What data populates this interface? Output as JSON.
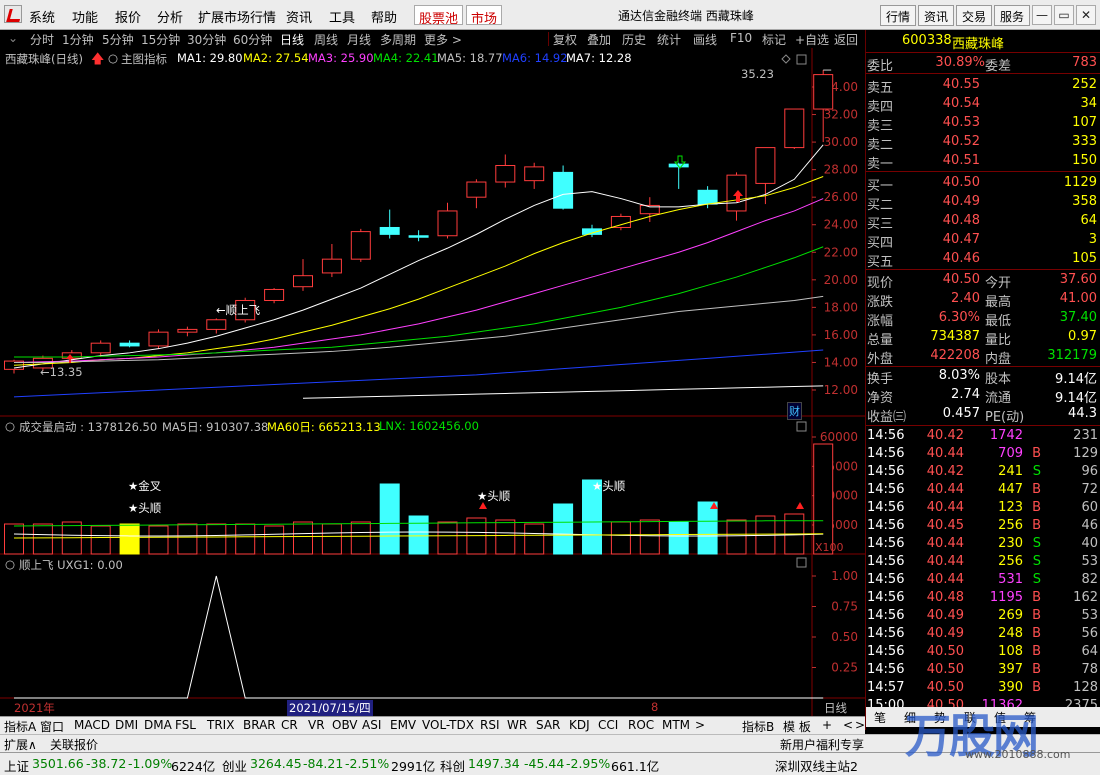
{
  "menu": {
    "items": [
      "系统",
      "功能",
      "报价",
      "分析",
      "扩展市场行情",
      "资讯",
      "工具",
      "帮助"
    ],
    "stock_pool": "股票池",
    "market": "市场"
  },
  "window": {
    "title": "通达信金融终端  西藏珠峰"
  },
  "right_buttons": [
    "行情",
    "资讯",
    "交易",
    "服务"
  ],
  "period_tabs": [
    "分时",
    "1分钟",
    "5分钟",
    "15分钟",
    "30分钟",
    "60分钟",
    "日线",
    "周线",
    "月线",
    "多周期",
    "更多 >"
  ],
  "selected_period": "日线",
  "tool_buttons": [
    "复权",
    "叠加",
    "历史",
    "统计",
    "画线",
    "F10",
    "标记",
    "+自选",
    "返回"
  ],
  "chart": {
    "stock_label": "西藏珠峰(日线)",
    "indicator_label": "主图指标",
    "ma": [
      {
        "label": "MA1: 29.80",
        "color": "#ffffff"
      },
      {
        "label": "MA2: 27.54",
        "color": "#ffff00"
      },
      {
        "label": "MA3: 25.90",
        "color": "#ff40ff"
      },
      {
        "label": "MA4: 22.41",
        "color": "#00e000"
      },
      {
        "label": "MA5: 18.77",
        "color": "#c0c0c0"
      },
      {
        "label": "MA6: 14.92",
        "color": "#2040ff"
      },
      {
        "label": "MA7: 12.28",
        "color": "#ffffff"
      }
    ],
    "high_label": "35.23",
    "low_label": "13.35",
    "annotation": "顺上飞",
    "fin_badge": "财",
    "y_ticks": [
      "34.00",
      "32.00",
      "30.00",
      "28.00",
      "26.00",
      "24.00",
      "22.00",
      "20.00",
      "18.00",
      "16.00",
      "14.00",
      "12.00"
    ]
  },
  "chart_data": {
    "type": "candlestick",
    "candles": [
      {
        "o": 13.5,
        "h": 14.2,
        "l": 13.2,
        "c": 14.1
      },
      {
        "o": 13.6,
        "h": 14.5,
        "l": 13.4,
        "c": 14.3
      },
      {
        "o": 14.3,
        "h": 14.9,
        "l": 14.0,
        "c": 14.7
      },
      {
        "o": 14.7,
        "h": 15.6,
        "l": 14.4,
        "c": 15.4
      },
      {
        "o": 15.4,
        "h": 15.6,
        "l": 15.1,
        "c": 15.2
      },
      {
        "o": 15.2,
        "h": 16.4,
        "l": 15.0,
        "c": 16.2
      },
      {
        "o": 16.2,
        "h": 16.6,
        "l": 15.9,
        "c": 16.4
      },
      {
        "o": 16.4,
        "h": 17.2,
        "l": 16.1,
        "c": 17.1
      },
      {
        "o": 17.1,
        "h": 18.7,
        "l": 16.9,
        "c": 18.5
      },
      {
        "o": 18.5,
        "h": 19.4,
        "l": 18.3,
        "c": 19.3
      },
      {
        "o": 19.5,
        "h": 21.5,
        "l": 19.2,
        "c": 20.3
      },
      {
        "o": 20.5,
        "h": 22.6,
        "l": 20.2,
        "c": 21.5
      },
      {
        "o": 21.5,
        "h": 23.7,
        "l": 21.3,
        "c": 23.5
      },
      {
        "o": 23.8,
        "h": 25.1,
        "l": 23.0,
        "c": 23.3
      },
      {
        "o": 23.2,
        "h": 23.6,
        "l": 22.8,
        "c": 23.1
      },
      {
        "o": 23.2,
        "h": 25.6,
        "l": 23.0,
        "c": 25.0
      },
      {
        "o": 26.0,
        "h": 27.3,
        "l": 25.2,
        "c": 27.1
      },
      {
        "o": 27.1,
        "h": 29.1,
        "l": 26.7,
        "c": 28.3
      },
      {
        "o": 27.2,
        "h": 28.5,
        "l": 26.6,
        "c": 28.2
      },
      {
        "o": 27.8,
        "h": 28.3,
        "l": 25.1,
        "c": 25.2
      },
      {
        "o": 23.7,
        "h": 24.0,
        "l": 23.1,
        "c": 23.3
      },
      {
        "o": 23.8,
        "h": 24.8,
        "l": 23.6,
        "c": 24.6
      },
      {
        "o": 24.8,
        "h": 26.0,
        "l": 24.2,
        "c": 25.4
      },
      {
        "o": 28.4,
        "h": 28.5,
        "l": 26.6,
        "c": 28.2
      },
      {
        "o": 26.5,
        "h": 26.8,
        "l": 25.2,
        "c": 25.5
      },
      {
        "o": 25.0,
        "h": 27.8,
        "l": 24.3,
        "c": 27.6
      },
      {
        "o": 27.0,
        "h": 29.6,
        "l": 25.5,
        "c": 29.6
      },
      {
        "o": 29.6,
        "h": 32.4,
        "l": 29.5,
        "c": 32.4
      },
      {
        "o": 32.4,
        "h": 35.23,
        "l": 30.0,
        "c": 34.9
      }
    ],
    "ma_series": [
      {
        "name": "MA1",
        "values": [
          13.6,
          13.9,
          14.2,
          14.5,
          14.7,
          15.0,
          15.4,
          15.9,
          16.5,
          17.1,
          17.8,
          18.6,
          19.4,
          20.4,
          21.4,
          22.3,
          23.3,
          24.4,
          25.4,
          26.2,
          26.4,
          25.9,
          25.3,
          25.3,
          25.5,
          25.6,
          26.2,
          27.3,
          29.8
        ]
      },
      {
        "name": "MA2",
        "values": [
          13.8,
          13.9,
          14.0,
          14.2,
          14.3,
          14.5,
          14.7,
          15.0,
          15.3,
          15.7,
          16.2,
          16.7,
          17.3,
          17.9,
          18.6,
          19.4,
          20.2,
          21.0,
          21.9,
          22.7,
          23.4,
          24.0,
          24.6,
          25.1,
          25.5,
          25.8,
          26.1,
          26.7,
          27.5
        ]
      },
      {
        "name": "MA3",
        "values": [
          14.0,
          14.05,
          14.1,
          14.2,
          14.3,
          14.4,
          14.55,
          14.7,
          14.9,
          15.1,
          15.4,
          15.7,
          16.0,
          16.4,
          16.8,
          17.3,
          17.8,
          18.4,
          19.0,
          19.6,
          20.2,
          20.8,
          21.4,
          22.0,
          22.7,
          23.5,
          24.3,
          25.0,
          25.9
        ]
      },
      {
        "name": "MA4",
        "values": [
          14.4,
          14.4,
          14.4,
          14.45,
          14.5,
          14.55,
          14.6,
          14.7,
          14.8,
          14.9,
          15.0,
          15.1,
          15.3,
          15.5,
          15.7,
          15.9,
          16.2,
          16.5,
          16.8,
          17.2,
          17.6,
          18.0,
          18.5,
          19.0,
          19.6,
          20.2,
          20.9,
          21.6,
          22.4
        ]
      },
      {
        "name": "MA5",
        "values": [
          14.0,
          14.0,
          14.05,
          14.1,
          14.15,
          14.2,
          14.3,
          14.4,
          14.5,
          14.6,
          14.7,
          14.8,
          14.95,
          15.1,
          15.3,
          15.5,
          15.7,
          15.9,
          16.2,
          16.5,
          16.8,
          17.1,
          17.4,
          17.7,
          17.9,
          18.1,
          18.3,
          18.5,
          18.8
        ]
      },
      {
        "name": "MA6",
        "values": [
          11.5,
          11.6,
          11.7,
          11.8,
          11.9,
          12.0,
          12.1,
          12.2,
          12.3,
          12.4,
          12.5,
          12.6,
          12.7,
          12.8,
          12.9,
          13.0,
          13.1,
          13.25,
          13.4,
          13.55,
          13.7,
          13.85,
          14.0,
          14.15,
          14.3,
          14.45,
          14.6,
          14.75,
          14.9
        ]
      },
      {
        "name": "MA7",
        "values": [
          null,
          null,
          null,
          null,
          null,
          null,
          null,
          null,
          null,
          null,
          11.4,
          11.45,
          11.5,
          11.55,
          11.6,
          11.65,
          11.7,
          11.75,
          11.8,
          11.85,
          11.9,
          11.95,
          12.0,
          12.05,
          12.1,
          12.15,
          12.2,
          12.25,
          12.3
        ]
      }
    ],
    "volume": [
      150000,
      150000,
      160000,
      140000,
      150000,
      140000,
      150000,
      150000,
      150000,
      140000,
      160000,
      150000,
      160000,
      350000,
      190000,
      160000,
      180000,
      170000,
      150000,
      250000,
      370000,
      160000,
      170000,
      160000,
      260000,
      170000,
      190000,
      200000,
      800000
    ],
    "volume_ma": {
      "ma5": [],
      "ma60": []
    },
    "y_range": [
      11.4,
      35.9
    ]
  },
  "volume_panel": {
    "label": "成交量启动 : 1378126.50",
    "ma5": "MA5日: 910307.38",
    "ma60": "MA60日: 665213.13",
    "lnx": "LNX: 1602456.00",
    "y_ticks": [
      "60000",
      "45000",
      "30000",
      "15000"
    ],
    "unit": "X100",
    "signals": [
      "★金叉",
      "★头顺",
      "★头顺",
      "★头顺"
    ]
  },
  "indicator_panel": {
    "label": "顺上飞  UXG1: 0.00",
    "y_ticks": [
      "1.00",
      "0.75",
      "0.50",
      "0.25"
    ]
  },
  "date_bar": {
    "year": "2021年",
    "date": "2021/07/15/四",
    "marker": "8",
    "period": "日线"
  },
  "indicator_tabs": [
    "指标A",
    "窗口",
    "MACD",
    "DMI",
    "DMA",
    "FSL",
    "TRIX",
    "BRAR",
    "CR",
    "VR",
    "OBV",
    "ASI",
    "EMV",
    "VOL-TDX",
    "RSI",
    "WR",
    "SAR",
    "KDJ",
    "CCI",
    "ROC",
    "MTM",
    ">",
    "指标B",
    "模 板",
    "+",
    "<",
    ">"
  ],
  "bottom_tabs": [
    "扩展∧",
    "关联报价"
  ],
  "promo": "新用户福利专享",
  "quote": {
    "code": "600338",
    "name": "西藏珠峰",
    "weibi_label": "委比",
    "weibi": "30.89%",
    "weicha_label": "委差",
    "weicha": "783",
    "asks": [
      {
        "l": "卖五",
        "p": "40.55",
        "v": "252"
      },
      {
        "l": "卖四",
        "p": "40.54",
        "v": "34"
      },
      {
        "l": "卖三",
        "p": "40.53",
        "v": "107"
      },
      {
        "l": "卖二",
        "p": "40.52",
        "v": "333"
      },
      {
        "l": "卖一",
        "p": "40.51",
        "v": "150"
      }
    ],
    "bids": [
      {
        "l": "买一",
        "p": "40.50",
        "v": "1129"
      },
      {
        "l": "买二",
        "p": "40.49",
        "v": "358"
      },
      {
        "l": "买三",
        "p": "40.48",
        "v": "64"
      },
      {
        "l": "买四",
        "p": "40.47",
        "v": "3"
      },
      {
        "l": "买五",
        "p": "40.46",
        "v": "105"
      }
    ],
    "stats": [
      [
        "现价",
        "40.50",
        "今开",
        "37.60"
      ],
      [
        "涨跌",
        "2.40",
        "最高",
        "41.00"
      ],
      [
        "涨幅",
        "6.30%",
        "最低",
        "37.40"
      ],
      [
        "总量",
        "734387",
        "量比",
        "0.97"
      ],
      [
        "外盘",
        "422208",
        "内盘",
        "312179"
      ]
    ],
    "stats2": [
      [
        "换手",
        "8.03%",
        "股本",
        "9.14亿"
      ],
      [
        "净资",
        "2.74",
        "流通",
        "9.14亿"
      ],
      [
        "收益㈢",
        "0.457",
        "PE(动)",
        "44.3"
      ]
    ],
    "ticks": [
      {
        "t": "14:56",
        "p": "40.42",
        "v": "1742",
        "bs": "",
        "n": "231"
      },
      {
        "t": "14:56",
        "p": "40.44",
        "v": "709",
        "bs": "B",
        "n": "129"
      },
      {
        "t": "14:56",
        "p": "40.42",
        "v": "241",
        "bs": "S",
        "n": "96"
      },
      {
        "t": "14:56",
        "p": "40.44",
        "v": "447",
        "bs": "B",
        "n": "72"
      },
      {
        "t": "14:56",
        "p": "40.44",
        "v": "123",
        "bs": "B",
        "n": "60"
      },
      {
        "t": "14:56",
        "p": "40.45",
        "v": "256",
        "bs": "B",
        "n": "46"
      },
      {
        "t": "14:56",
        "p": "40.44",
        "v": "230",
        "bs": "S",
        "n": "40"
      },
      {
        "t": "14:56",
        "p": "40.44",
        "v": "256",
        "bs": "S",
        "n": "53"
      },
      {
        "t": "14:56",
        "p": "40.44",
        "v": "531",
        "bs": "S",
        "n": "82"
      },
      {
        "t": "14:56",
        "p": "40.48",
        "v": "1195",
        "bs": "B",
        "n": "162"
      },
      {
        "t": "14:56",
        "p": "40.49",
        "v": "269",
        "bs": "B",
        "n": "53"
      },
      {
        "t": "14:56",
        "p": "40.49",
        "v": "248",
        "bs": "B",
        "n": "56"
      },
      {
        "t": "14:56",
        "p": "40.50",
        "v": "108",
        "bs": "B",
        "n": "64"
      },
      {
        "t": "14:56",
        "p": "40.50",
        "v": "397",
        "bs": "B",
        "n": "78"
      },
      {
        "t": "14:57",
        "p": "40.50",
        "v": "390",
        "bs": "B",
        "n": "128"
      },
      {
        "t": "15:00",
        "p": "40.50",
        "v": "11362",
        "bs": "",
        "n": "2375"
      }
    ],
    "side_tabs": [
      "笔",
      "细",
      "势",
      "联",
      "值",
      "筹"
    ]
  },
  "status": {
    "sh_label": "上证",
    "sh": "3501.66",
    "sh_chg": "-38.72",
    "sh_pct": "-1.09%",
    "sh_amt": "6224亿",
    "cy_label": "创业",
    "cy": "3264.45",
    "cy_chg": "-84.21",
    "cy_pct": "-2.51%",
    "cy_amt": "2991亿",
    "kc_label": "科创",
    "kc": "1497.34",
    "kc_chg": "-45.44",
    "kc_pct": "-2.95%",
    "kc_amt": "661.1亿",
    "server": "深圳双线主站2"
  },
  "watermark": "万股网",
  "watermark_url": "www.2010888.com",
  "colors": {
    "up": "#ff3c3c",
    "down": "#40ffff",
    "bg": "#000000",
    "grid": "#700000"
  }
}
